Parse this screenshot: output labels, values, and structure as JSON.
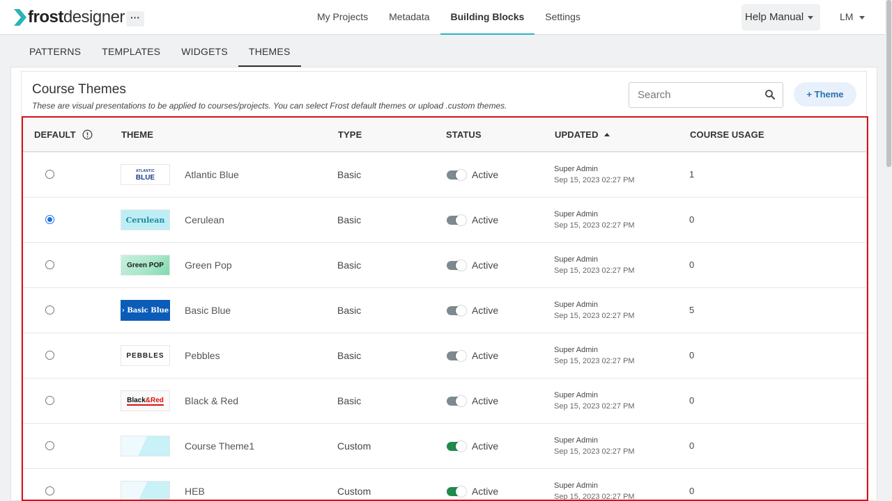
{
  "app": {
    "logo_bold": "frost",
    "logo_light": "designer",
    "more": "···"
  },
  "nav": [
    {
      "label": "My Projects",
      "active": false
    },
    {
      "label": "Metadata",
      "active": false
    },
    {
      "label": "Building Blocks",
      "active": true
    },
    {
      "label": "Settings",
      "active": false
    }
  ],
  "help": {
    "label": "Help Manual"
  },
  "user": {
    "initials": "LM"
  },
  "subtabs": [
    {
      "label": "PATTERNS",
      "active": false
    },
    {
      "label": "TEMPLATES",
      "active": false
    },
    {
      "label": "WIDGETS",
      "active": false
    },
    {
      "label": "THEMES",
      "active": true
    }
  ],
  "page": {
    "title": "Course Themes",
    "subtitle": "These are visual presentations to be applied to courses/projects. You can select Frost default themes or upload .custom themes.",
    "search_placeholder": "Search",
    "add_button": "+ Theme"
  },
  "table": {
    "headers": {
      "default": "DEFAULT",
      "theme": "THEME",
      "type": "TYPE",
      "status": "STATUS",
      "updated": "UPDATED",
      "usage": "COURSE USAGE"
    },
    "rows": [
      {
        "default": false,
        "thumb_text": "ATLANTIC BLUE",
        "name": "Atlantic Blue",
        "type": "Basic",
        "status": "Active",
        "toggle": "gray",
        "updated_by": "Super Admin",
        "updated_at": "Sep 15, 2023 02:27 PM",
        "usage": "1"
      },
      {
        "default": true,
        "thumb_text": "Cerulean",
        "name": "Cerulean",
        "type": "Basic",
        "status": "Active",
        "toggle": "gray",
        "updated_by": "Super Admin",
        "updated_at": "Sep 15, 2023 02:27 PM",
        "usage": "0"
      },
      {
        "default": false,
        "thumb_text": "Green POP",
        "name": "Green Pop",
        "type": "Basic",
        "status": "Active",
        "toggle": "gray",
        "updated_by": "Super Admin",
        "updated_at": "Sep 15, 2023 02:27 PM",
        "usage": "0"
      },
      {
        "default": false,
        "thumb_text": "› Basic Blue",
        "name": "Basic Blue",
        "type": "Basic",
        "status": "Active",
        "toggle": "gray",
        "updated_by": "Super Admin",
        "updated_at": "Sep 15, 2023 02:27 PM",
        "usage": "5"
      },
      {
        "default": false,
        "thumb_text": "PEBBLES",
        "name": "Pebbles",
        "type": "Basic",
        "status": "Active",
        "toggle": "gray",
        "updated_by": "Super Admin",
        "updated_at": "Sep 15, 2023 02:27 PM",
        "usage": "0"
      },
      {
        "default": false,
        "thumb_text": "Black&Red",
        "name": "Black & Red",
        "type": "Basic",
        "status": "Active",
        "toggle": "gray",
        "updated_by": "Super Admin",
        "updated_at": "Sep 15, 2023 02:27 PM",
        "usage": "0"
      },
      {
        "default": false,
        "thumb_text": "",
        "name": "Course Theme1",
        "type": "Custom",
        "status": "Active",
        "toggle": "green",
        "updated_by": "Super Admin",
        "updated_at": "Sep 15, 2023 02:27 PM",
        "usage": "0"
      },
      {
        "default": false,
        "thumb_text": "",
        "name": "HEB",
        "type": "Custom",
        "status": "Active",
        "toggle": "green",
        "updated_by": "Super Admin",
        "updated_at": "Sep 15, 2023 02:27 PM",
        "usage": "0"
      }
    ]
  }
}
